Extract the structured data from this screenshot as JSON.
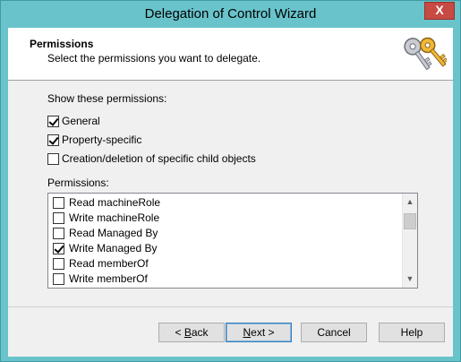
{
  "window": {
    "title": "Delegation of Control Wizard",
    "close_glyph": "X"
  },
  "header": {
    "title": "Permissions",
    "subtitle": "Select the permissions you want to delegate.",
    "icon": "keys-icon"
  },
  "show_section": {
    "label": "Show these permissions:",
    "options": [
      {
        "label": "General",
        "checked": true
      },
      {
        "label": "Property-specific",
        "checked": true
      },
      {
        "label": "Creation/deletion of specific child objects",
        "checked": false
      }
    ]
  },
  "permissions": {
    "label": "Permissions:",
    "items": [
      {
        "label": "Read machineRole",
        "checked": false
      },
      {
        "label": "Write machineRole",
        "checked": false
      },
      {
        "label": "Read Managed By",
        "checked": false
      },
      {
        "label": "Write Managed By",
        "checked": true
      },
      {
        "label": "Read memberOf",
        "checked": false
      },
      {
        "label": "Write memberOf",
        "checked": false
      }
    ]
  },
  "buttons": {
    "back": {
      "prefix": "< ",
      "accel": "B",
      "rest": "ack"
    },
    "next": {
      "accel": "N",
      "rest": "ext >"
    },
    "cancel": "Cancel",
    "help": "Help"
  }
}
